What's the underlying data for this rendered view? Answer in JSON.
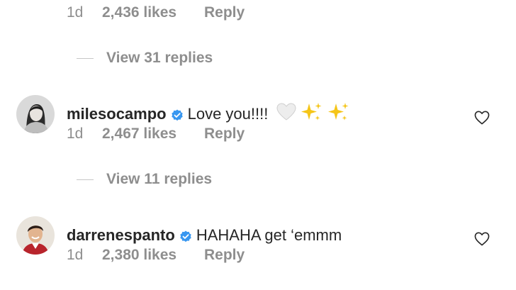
{
  "top_comment": {
    "time": "1d",
    "likes": "2,436 likes",
    "reply": "Reply"
  },
  "thread1": {
    "view_replies": "View 31 replies"
  },
  "comment1": {
    "username": "milesocampo",
    "text": "Love you!!!!",
    "emojis": "🤍 ✨ ✨",
    "time": "1d",
    "likes": "2,467 likes",
    "reply": "Reply"
  },
  "thread2": {
    "view_replies": "View 11 replies"
  },
  "comment2": {
    "username": "darrenespanto",
    "text": "HAHAHA get ‘emmm",
    "time": "1d",
    "likes": "2,380 likes",
    "reply": "Reply"
  },
  "colors": {
    "verified_badge": "#3897f0",
    "meta_text": "#8e8e8e",
    "sparkle": "#f5c518"
  }
}
